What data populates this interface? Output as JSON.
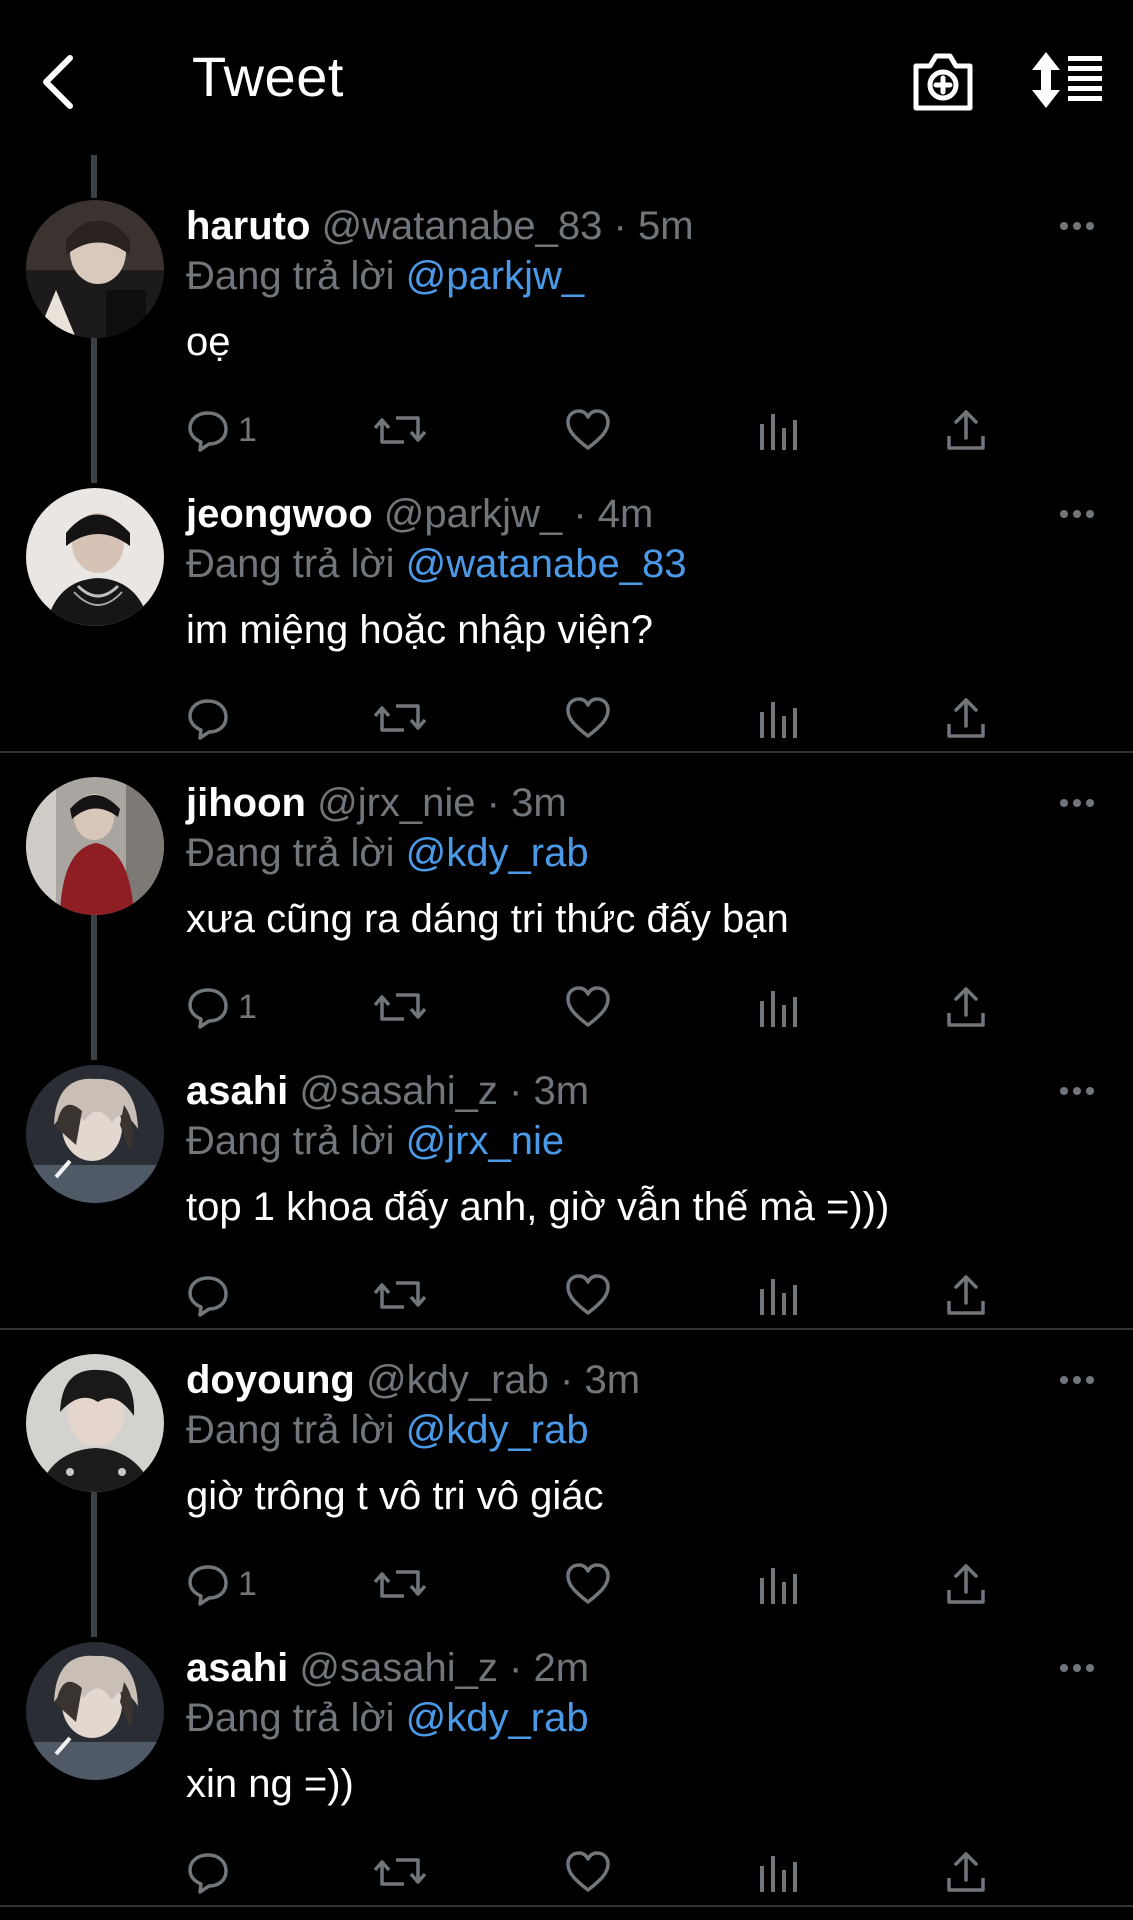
{
  "header": {
    "title": "Tweet",
    "back_icon": "chevron-left-icon",
    "camera_icon": "camera-plus-icon",
    "sort_icon": "sort-list-icon"
  },
  "colors": {
    "background": "#000000",
    "name": "#ffffff",
    "secondary": "#71767b",
    "link": "#4b9ae8",
    "thread_line": "#3b4045",
    "separator": "#2f3336"
  },
  "reply_prefix": "Đang trả lời",
  "tweets": [
    {
      "name": "haruto",
      "handle": "@watanabe_83",
      "separator": "·",
      "time": "5m",
      "reply_to": "@parkjw_",
      "text": "oẹ",
      "reply_count": "1"
    },
    {
      "name": "jeongwoo",
      "handle": "@parkjw_",
      "separator": "·",
      "time": "4m",
      "reply_to": "@watanabe_83",
      "text": "im miệng hoặc nhập viện?",
      "reply_count": ""
    },
    {
      "name": "jihoon",
      "handle": "@jrx_nie",
      "separator": "·",
      "time": "3m",
      "reply_to": "@kdy_rab",
      "text": "xưa cũng ra dáng tri thức đấy bạn",
      "reply_count": "1"
    },
    {
      "name": "asahi",
      "handle": "@sasahi_z",
      "separator": "·",
      "time": "3m",
      "reply_to": "@jrx_nie",
      "text": "top 1 khoa đấy anh, giờ vẫn thế mà =)))",
      "reply_count": ""
    },
    {
      "name": "doyoung",
      "handle": "@kdy_rab",
      "separator": "·",
      "time": "3m",
      "reply_to": "@kdy_rab",
      "text": "giờ trông t vô tri vô giác",
      "reply_count": "1"
    },
    {
      "name": "asahi",
      "handle": "@sasahi_z",
      "separator": "·",
      "time": "2m",
      "reply_to": "@kdy_rab",
      "text": "xin ng =))",
      "reply_count": ""
    }
  ]
}
